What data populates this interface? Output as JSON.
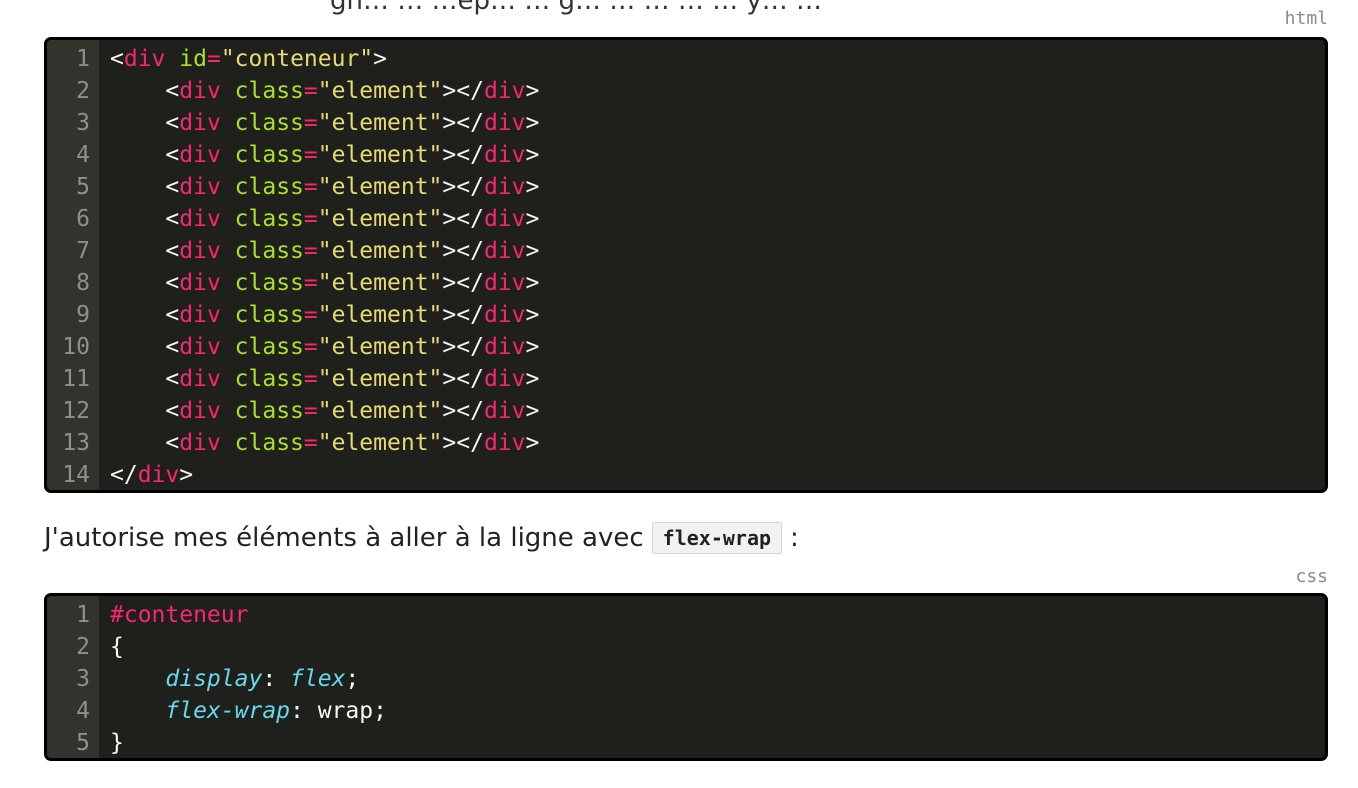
{
  "cropped_top_text": "gn… … …ep… … g… … … … … y… …",
  "html_block": {
    "lang": "html",
    "lines": [
      {
        "n": "1",
        "tokens": [
          {
            "t": "<",
            "c": "plain"
          },
          {
            "t": "div",
            "c": "tag"
          },
          {
            "t": " ",
            "c": "plain"
          },
          {
            "t": "id",
            "c": "attr"
          },
          {
            "t": "=",
            "c": "eq"
          },
          {
            "t": "\"conteneur\"",
            "c": "str"
          },
          {
            "t": ">",
            "c": "plain"
          }
        ]
      },
      {
        "n": "2",
        "tokens": [
          {
            "t": "    <",
            "c": "plain"
          },
          {
            "t": "div",
            "c": "tag"
          },
          {
            "t": " ",
            "c": "plain"
          },
          {
            "t": "class",
            "c": "attr"
          },
          {
            "t": "=",
            "c": "eq"
          },
          {
            "t": "\"element\"",
            "c": "str"
          },
          {
            "t": "></",
            "c": "plain"
          },
          {
            "t": "div",
            "c": "tag"
          },
          {
            "t": ">",
            "c": "plain"
          }
        ]
      },
      {
        "n": "3",
        "tokens": [
          {
            "t": "    <",
            "c": "plain"
          },
          {
            "t": "div",
            "c": "tag"
          },
          {
            "t": " ",
            "c": "plain"
          },
          {
            "t": "class",
            "c": "attr"
          },
          {
            "t": "=",
            "c": "eq"
          },
          {
            "t": "\"element\"",
            "c": "str"
          },
          {
            "t": "></",
            "c": "plain"
          },
          {
            "t": "div",
            "c": "tag"
          },
          {
            "t": ">",
            "c": "plain"
          }
        ]
      },
      {
        "n": "4",
        "tokens": [
          {
            "t": "    <",
            "c": "plain"
          },
          {
            "t": "div",
            "c": "tag"
          },
          {
            "t": " ",
            "c": "plain"
          },
          {
            "t": "class",
            "c": "attr"
          },
          {
            "t": "=",
            "c": "eq"
          },
          {
            "t": "\"element\"",
            "c": "str"
          },
          {
            "t": "></",
            "c": "plain"
          },
          {
            "t": "div",
            "c": "tag"
          },
          {
            "t": ">",
            "c": "plain"
          }
        ]
      },
      {
        "n": "5",
        "tokens": [
          {
            "t": "    <",
            "c": "plain"
          },
          {
            "t": "div",
            "c": "tag"
          },
          {
            "t": " ",
            "c": "plain"
          },
          {
            "t": "class",
            "c": "attr"
          },
          {
            "t": "=",
            "c": "eq"
          },
          {
            "t": "\"element\"",
            "c": "str"
          },
          {
            "t": "></",
            "c": "plain"
          },
          {
            "t": "div",
            "c": "tag"
          },
          {
            "t": ">",
            "c": "plain"
          }
        ]
      },
      {
        "n": "6",
        "tokens": [
          {
            "t": "    <",
            "c": "plain"
          },
          {
            "t": "div",
            "c": "tag"
          },
          {
            "t": " ",
            "c": "plain"
          },
          {
            "t": "class",
            "c": "attr"
          },
          {
            "t": "=",
            "c": "eq"
          },
          {
            "t": "\"element\"",
            "c": "str"
          },
          {
            "t": "></",
            "c": "plain"
          },
          {
            "t": "div",
            "c": "tag"
          },
          {
            "t": ">",
            "c": "plain"
          }
        ]
      },
      {
        "n": "7",
        "tokens": [
          {
            "t": "    <",
            "c": "plain"
          },
          {
            "t": "div",
            "c": "tag"
          },
          {
            "t": " ",
            "c": "plain"
          },
          {
            "t": "class",
            "c": "attr"
          },
          {
            "t": "=",
            "c": "eq"
          },
          {
            "t": "\"element\"",
            "c": "str"
          },
          {
            "t": "></",
            "c": "plain"
          },
          {
            "t": "div",
            "c": "tag"
          },
          {
            "t": ">",
            "c": "plain"
          }
        ]
      },
      {
        "n": "8",
        "tokens": [
          {
            "t": "    <",
            "c": "plain"
          },
          {
            "t": "div",
            "c": "tag"
          },
          {
            "t": " ",
            "c": "plain"
          },
          {
            "t": "class",
            "c": "attr"
          },
          {
            "t": "=",
            "c": "eq"
          },
          {
            "t": "\"element\"",
            "c": "str"
          },
          {
            "t": "></",
            "c": "plain"
          },
          {
            "t": "div",
            "c": "tag"
          },
          {
            "t": ">",
            "c": "plain"
          }
        ]
      },
      {
        "n": "9",
        "tokens": [
          {
            "t": "    <",
            "c": "plain"
          },
          {
            "t": "div",
            "c": "tag"
          },
          {
            "t": " ",
            "c": "plain"
          },
          {
            "t": "class",
            "c": "attr"
          },
          {
            "t": "=",
            "c": "eq"
          },
          {
            "t": "\"element\"",
            "c": "str"
          },
          {
            "t": "></",
            "c": "plain"
          },
          {
            "t": "div",
            "c": "tag"
          },
          {
            "t": ">",
            "c": "plain"
          }
        ]
      },
      {
        "n": "10",
        "tokens": [
          {
            "t": "    <",
            "c": "plain"
          },
          {
            "t": "div",
            "c": "tag"
          },
          {
            "t": " ",
            "c": "plain"
          },
          {
            "t": "class",
            "c": "attr"
          },
          {
            "t": "=",
            "c": "eq"
          },
          {
            "t": "\"element\"",
            "c": "str"
          },
          {
            "t": "></",
            "c": "plain"
          },
          {
            "t": "div",
            "c": "tag"
          },
          {
            "t": ">",
            "c": "plain"
          }
        ]
      },
      {
        "n": "11",
        "tokens": [
          {
            "t": "    <",
            "c": "plain"
          },
          {
            "t": "div",
            "c": "tag"
          },
          {
            "t": " ",
            "c": "plain"
          },
          {
            "t": "class",
            "c": "attr"
          },
          {
            "t": "=",
            "c": "eq"
          },
          {
            "t": "\"element\"",
            "c": "str"
          },
          {
            "t": "></",
            "c": "plain"
          },
          {
            "t": "div",
            "c": "tag"
          },
          {
            "t": ">",
            "c": "plain"
          }
        ]
      },
      {
        "n": "12",
        "tokens": [
          {
            "t": "    <",
            "c": "plain"
          },
          {
            "t": "div",
            "c": "tag"
          },
          {
            "t": " ",
            "c": "plain"
          },
          {
            "t": "class",
            "c": "attr"
          },
          {
            "t": "=",
            "c": "eq"
          },
          {
            "t": "\"element\"",
            "c": "str"
          },
          {
            "t": "></",
            "c": "plain"
          },
          {
            "t": "div",
            "c": "tag"
          },
          {
            "t": ">",
            "c": "plain"
          }
        ]
      },
      {
        "n": "13",
        "tokens": [
          {
            "t": "    <",
            "c": "plain"
          },
          {
            "t": "div",
            "c": "tag"
          },
          {
            "t": " ",
            "c": "plain"
          },
          {
            "t": "class",
            "c": "attr"
          },
          {
            "t": "=",
            "c": "eq"
          },
          {
            "t": "\"element\"",
            "c": "str"
          },
          {
            "t": "></",
            "c": "plain"
          },
          {
            "t": "div",
            "c": "tag"
          },
          {
            "t": ">",
            "c": "plain"
          }
        ]
      },
      {
        "n": "14",
        "tokens": [
          {
            "t": "</",
            "c": "plain"
          },
          {
            "t": "div",
            "c": "tag"
          },
          {
            "t": ">",
            "c": "plain"
          }
        ]
      }
    ]
  },
  "paragraph": {
    "before": "J'autorise mes éléments à aller à la ligne avec",
    "code": "flex-wrap",
    "after": ":"
  },
  "css_block": {
    "lang": "css",
    "lines": [
      {
        "n": "1",
        "tokens": [
          {
            "t": "#conteneur",
            "c": "sel"
          }
        ]
      },
      {
        "n": "2",
        "tokens": [
          {
            "t": "{",
            "c": "plain"
          }
        ]
      },
      {
        "n": "3",
        "tokens": [
          {
            "t": "    ",
            "c": "plain"
          },
          {
            "t": "display",
            "c": "prop"
          },
          {
            "t": ": ",
            "c": "plain"
          },
          {
            "t": "flex",
            "c": "kw"
          },
          {
            "t": ";",
            "c": "plain"
          }
        ]
      },
      {
        "n": "4",
        "tokens": [
          {
            "t": "    ",
            "c": "plain"
          },
          {
            "t": "flex-wrap",
            "c": "prop"
          },
          {
            "t": ": wrap;",
            "c": "plain"
          }
        ]
      },
      {
        "n": "5",
        "tokens": [
          {
            "t": "}",
            "c": "plain"
          }
        ]
      }
    ]
  },
  "colors": {
    "code_bg": "#1f1f1b",
    "gutter_bg": "#32332d",
    "tag": "#f92672",
    "attr": "#a6e22e",
    "string": "#e6db74",
    "property": "#66d9ef"
  }
}
